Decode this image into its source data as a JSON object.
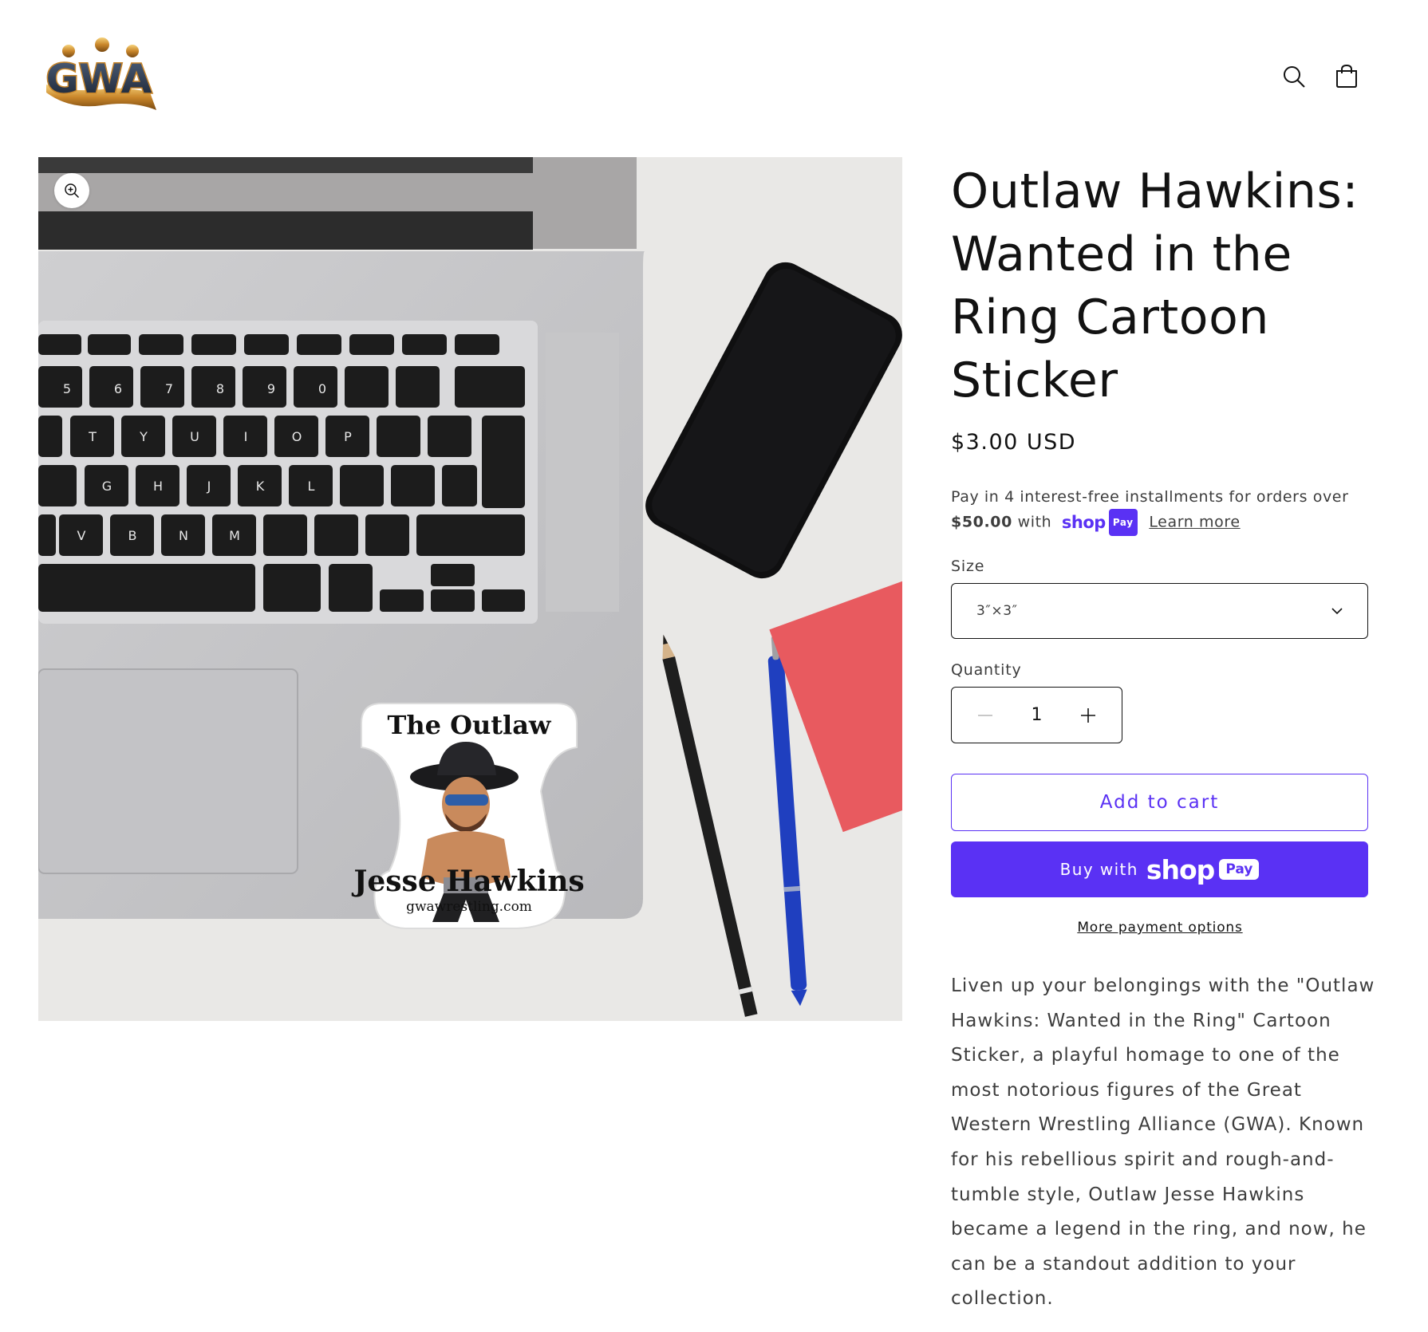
{
  "header": {
    "logo_text": "GWA",
    "search_icon": "search-icon",
    "cart_icon": "cart-icon"
  },
  "media": {
    "zoom_icon": "zoom-in-icon",
    "sticker": {
      "heading": "The Outlaw",
      "name": "Jesse Hawkins",
      "url": "gwawrestling.com"
    }
  },
  "product": {
    "title": "Outlaw Hawkins: Wanted in the Ring Cartoon Sticker",
    "price": "$3.00 USD",
    "installments_text": "Pay in 4 interest-free installments for orders over",
    "installments_threshold": "$50.00",
    "installments_with": "with",
    "shop_pay_word": "shop",
    "shop_pay_chip": "Pay",
    "learn_more": "Learn more",
    "size_label": "Size",
    "size_value": "3″×3″",
    "quantity_label": "Quantity",
    "quantity_value": "1",
    "add_to_cart": "Add to cart",
    "buy_with": "Buy with",
    "more_payment_options": "More payment options",
    "description": "Liven up your belongings with the \"Outlaw Hawkins: Wanted in the Ring\" Cartoon Sticker, a playful homage to one of the most notorious figures of the Great Western Wrestling Alliance (GWA). Known for his rebellious spirit and rough-and-tumble style, Outlaw Jesse Hawkins became a legend in the ring, and now, he can be a standout addition to your collection."
  },
  "colors": {
    "accent": "#5a31f4",
    "text": "#121212",
    "muted": "#3d3d3d"
  }
}
